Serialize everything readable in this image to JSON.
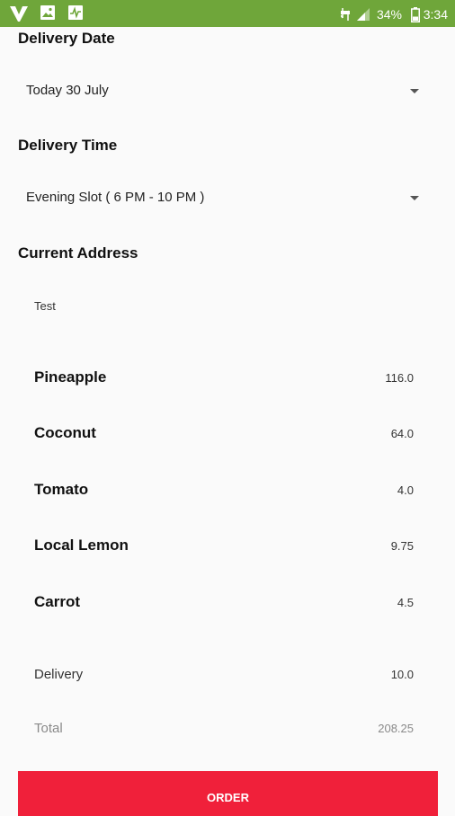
{
  "status_bar": {
    "battery_percent": "34%",
    "time": "3:34",
    "icons": [
      "app-logo-icon",
      "image-icon",
      "activity-icon",
      "signal-icon",
      "battery-icon"
    ],
    "color": "#6fa63a"
  },
  "delivery_date": {
    "title": "Delivery Date",
    "selected": "Today 30 July"
  },
  "delivery_time": {
    "title": "Delivery Time",
    "selected": "Evening Slot ( 6 PM - 10 PM )"
  },
  "current_address": {
    "title": "Current Address",
    "value": "Test"
  },
  "items": [
    {
      "name": "Pineapple",
      "price": "116.0"
    },
    {
      "name": "Coconut",
      "price": "64.0"
    },
    {
      "name": "Tomato",
      "price": "4.0"
    },
    {
      "name": "Local Lemon",
      "price": "9.75"
    },
    {
      "name": "Carrot",
      "price": "4.5"
    }
  ],
  "summary": {
    "delivery_label": "Delivery",
    "delivery_value": "10.0",
    "total_label": "Total",
    "total_value": "208.25"
  },
  "order_button": {
    "label": "ORDER",
    "color": "#f0203a"
  }
}
